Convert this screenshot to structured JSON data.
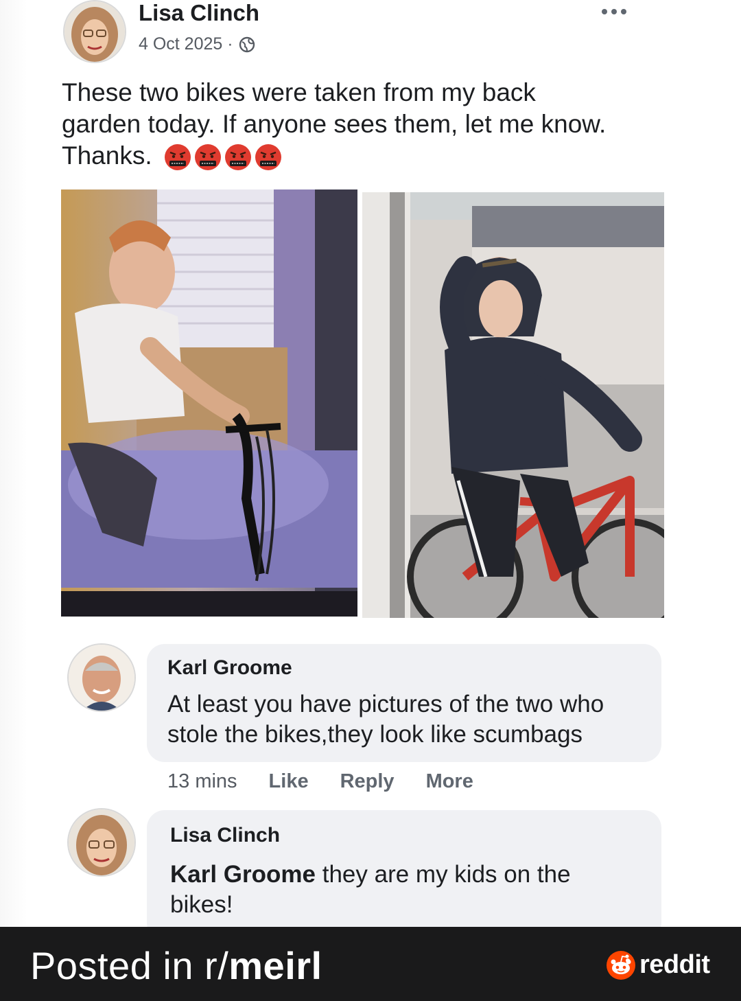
{
  "post": {
    "author": "Lisa Clinch",
    "date": "4 Oct 2025 ·",
    "text_line1": "These two bikes were taken from my back",
    "text_line2": "garden today. If anyone sees them, let me know.",
    "text_line3": "Thanks.",
    "emoji_count": 4,
    "emoji_name": "angry-swearing-face"
  },
  "comments": [
    {
      "author": "Karl Groome",
      "text_line1": "At least you have pictures of the two who",
      "text_line2": "stole the bikes,they look like scumbags",
      "time": "13 mins",
      "like": "Like",
      "reply": "Reply",
      "more": "More"
    },
    {
      "author": "Lisa Clinch",
      "mention": "Karl Groome",
      "text_rest": " they are my kids on the",
      "text_line2": "bikes!"
    }
  ],
  "footer": {
    "prefix": "Posted in r/",
    "subreddit": "meirl",
    "brand": "reddit"
  },
  "colors": {
    "footer_bg": "#1a1a1b",
    "bubble_bg": "#f0f1f4",
    "reddit_orange": "#ff4500",
    "bike_red": "#c8382c"
  }
}
